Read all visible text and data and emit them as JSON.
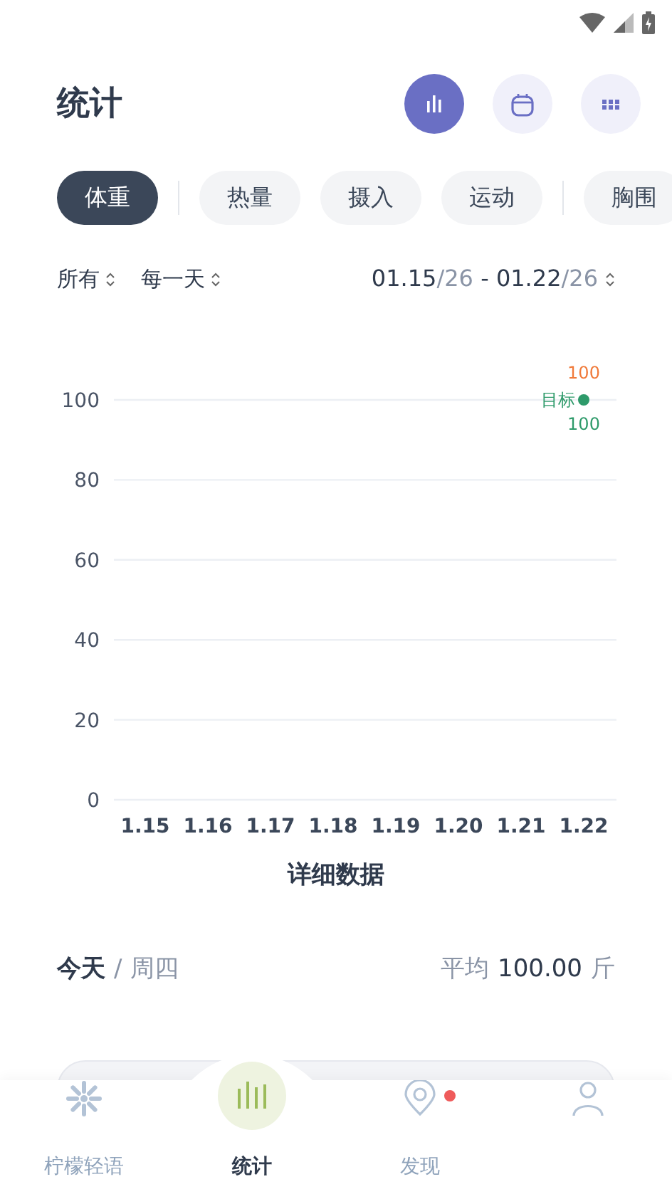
{
  "header": {
    "title": "统计",
    "actions": [
      {
        "kind": "chart",
        "selected": true
      },
      {
        "kind": "calendar",
        "selected": false
      },
      {
        "kind": "grid",
        "selected": false
      }
    ]
  },
  "tab_groups": [
    [
      {
        "label": "体重",
        "selected": true
      }
    ],
    [
      {
        "label": "热量",
        "selected": false
      },
      {
        "label": "摄入",
        "selected": false
      },
      {
        "label": "运动",
        "selected": false
      }
    ],
    [
      {
        "label": "胸围",
        "selected": false
      }
    ]
  ],
  "filters": [
    {
      "label": "所有"
    },
    {
      "label": "每一天"
    }
  ],
  "date_range": {
    "start": "01.15",
    "start_year": "/26",
    "separator": "-",
    "end": "01.22",
    "end_year": "/26"
  },
  "chart_data": {
    "type": "line",
    "categories": [
      "1.15",
      "1.16",
      "1.17",
      "1.18",
      "1.19",
      "1.20",
      "1.21",
      "1.22"
    ],
    "series": [
      {
        "name": "目标",
        "color": "#2e9a6a",
        "marker": true,
        "values": [
          null,
          null,
          null,
          null,
          null,
          null,
          null,
          100
        ]
      }
    ],
    "ylim": [
      0,
      100
    ],
    "yticks": [
      0,
      20,
      40,
      60,
      80,
      100
    ],
    "grid": true,
    "data_labels": true,
    "annotations": [
      {
        "x": "1.22",
        "y": 100,
        "text": "100"
      }
    ]
  },
  "detail": {
    "title": "详细数据",
    "day": "今天",
    "separator": "/",
    "weekday": "周四",
    "average_label": "平均",
    "average_value": "100.00",
    "unit": "斤"
  },
  "bottom_nav": [
    {
      "kind": "spark",
      "label": "柠檬轻语",
      "selected": false,
      "badge": false
    },
    {
      "kind": "bars",
      "label": "统计",
      "selected": true,
      "badge": false
    },
    {
      "kind": "pin",
      "label": "发现",
      "selected": false,
      "badge": true
    },
    {
      "kind": "person",
      "selected": false,
      "badge": false
    }
  ]
}
